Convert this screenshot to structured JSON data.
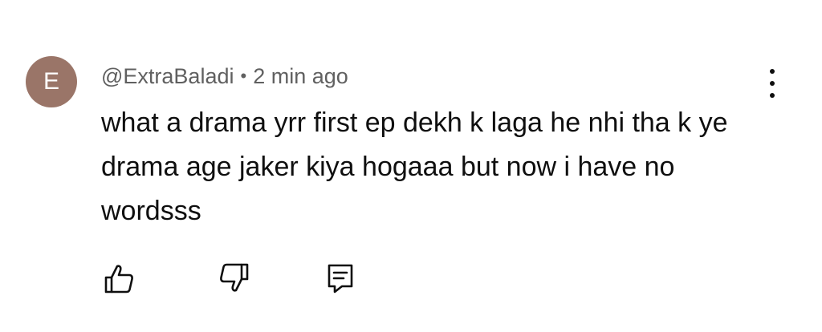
{
  "comment": {
    "avatar_letter": "E",
    "avatar_color": "#9a7568",
    "author": "@ExtraBaladi",
    "separator": "•",
    "time": "2 min ago",
    "text": "what a drama yrr first ep dekh k laga he nhi tha k ye drama age jaker kiya hogaaa but now i have no wordsss",
    "actions": [
      {
        "icon": "thumbs-up-icon"
      },
      {
        "icon": "thumbs-down-icon"
      },
      {
        "icon": "reply-icon"
      }
    ],
    "menu_icon": "more-vertical-icon"
  }
}
